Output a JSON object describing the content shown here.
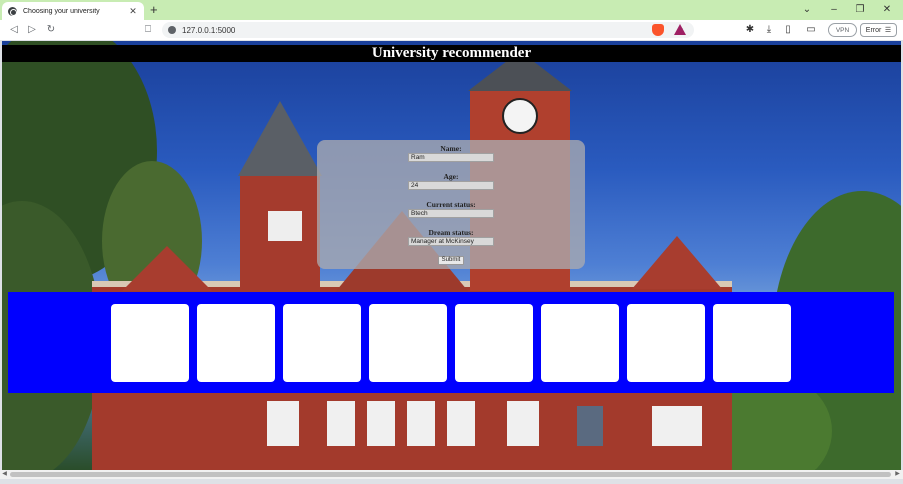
{
  "browser": {
    "tab_title": "Choosing your university",
    "tab_close": "✕",
    "new_tab": "+",
    "url": "127.0.0.1:5000",
    "vpn_label": "VPN",
    "error_label": "Error",
    "window_controls": {
      "collapse": "⌄",
      "minimize": "–",
      "maximize": "❐",
      "close": "✕"
    },
    "nav": {
      "back": "◁",
      "forward": "▷",
      "reload": "↻",
      "bookmark": "⎕"
    }
  },
  "page": {
    "heading": "University recommender",
    "form": {
      "fields": [
        {
          "label": "Name:",
          "value": "Ram"
        },
        {
          "label": "Age:",
          "value": "24"
        },
        {
          "label": "Current status:",
          "value": "Btech"
        },
        {
          "label": "Dream status:",
          "value": "Manager at McKinsey"
        }
      ],
      "submit_label": "Submit"
    },
    "cards_count": 8
  },
  "colors": {
    "panel_blue": "#0000ff",
    "header_black": "#000000",
    "titlebar_green": "#c8ecb3"
  }
}
